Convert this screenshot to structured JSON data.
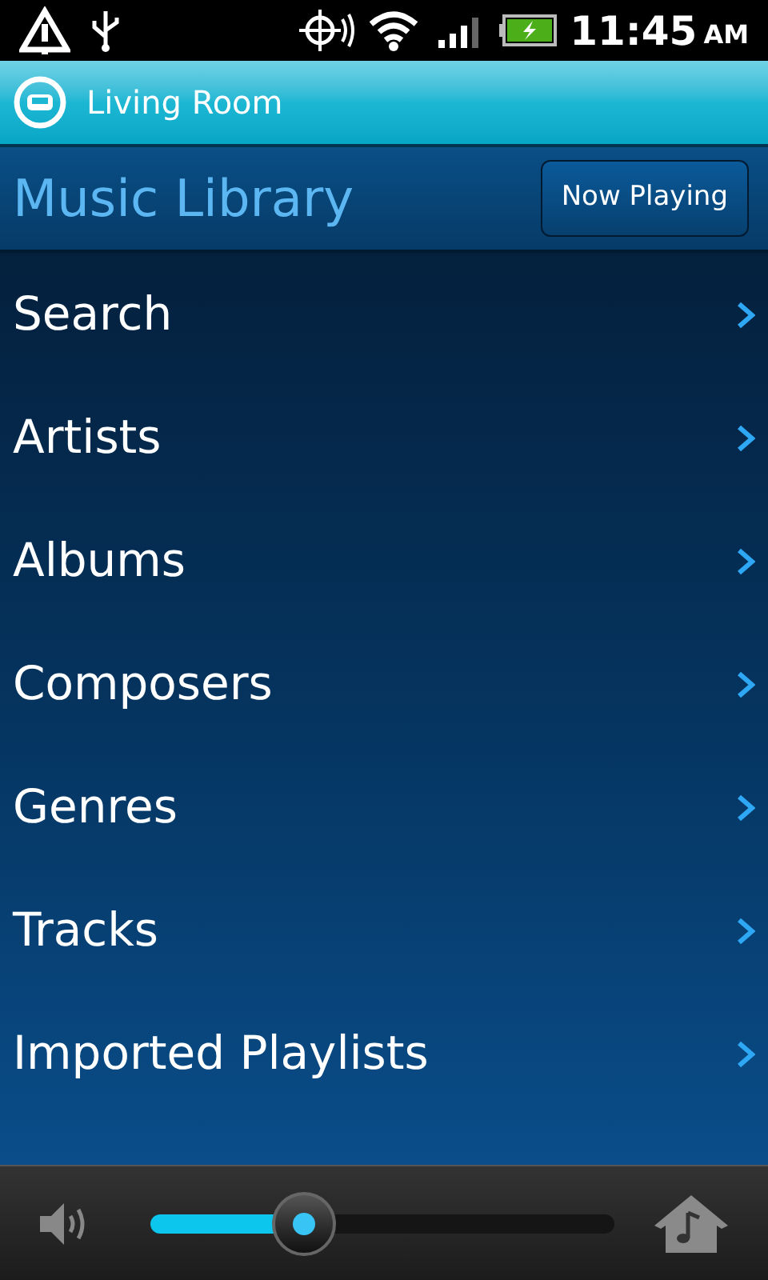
{
  "status_bar": {
    "time": "11:45",
    "meridiem": "AM"
  },
  "room": {
    "name": "Living Room"
  },
  "header": {
    "title": "Music Library",
    "button": "Now Playing"
  },
  "menu": [
    {
      "label": "Search"
    },
    {
      "label": "Artists"
    },
    {
      "label": "Albums"
    },
    {
      "label": "Composers"
    },
    {
      "label": "Genres"
    },
    {
      "label": "Tracks"
    },
    {
      "label": "Imported Playlists"
    }
  ],
  "volume": {
    "level": 0.33
  }
}
